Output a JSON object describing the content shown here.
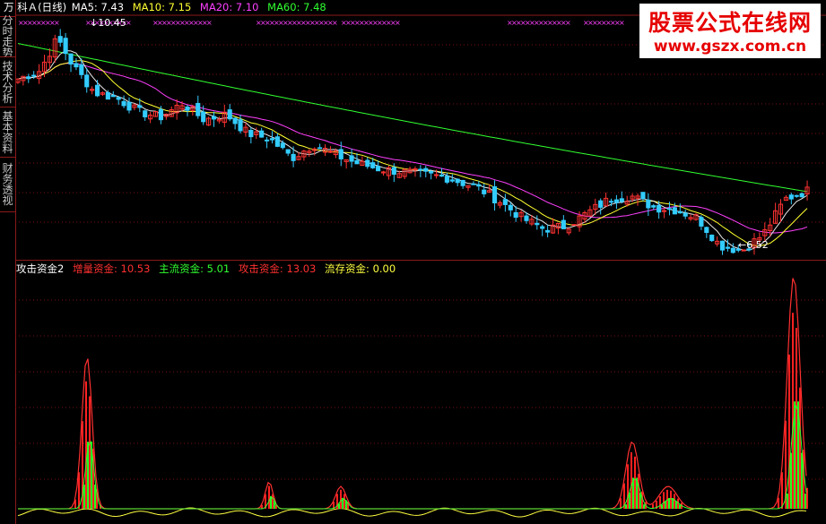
{
  "stock": {
    "name": "万 科Ａ(日线)",
    "ma5_label": "MA5:",
    "ma5": "7.43",
    "ma10_label": "MA10:",
    "ma10": "7.15",
    "ma20_label": "MA20:",
    "ma20": "7.10",
    "ma60_label": "MA60:",
    "ma60": "7.48"
  },
  "side_tabs": [
    {
      "label": "分时走势"
    },
    {
      "label": "技术分析"
    },
    {
      "label": "基本资料"
    },
    {
      "label": "财务透视"
    }
  ],
  "indicator": {
    "name": "攻击资金2",
    "items": [
      {
        "label": "增量资金:",
        "value": "10.53",
        "color": "#ff3030"
      },
      {
        "label": "主流资金:",
        "value": "5.01",
        "color": "#30ff30"
      },
      {
        "label": "攻击资金:",
        "value": "13.03",
        "color": "#ff3030"
      },
      {
        "label": "流存资金:",
        "value": "0.00",
        "color": "#ffff40"
      }
    ]
  },
  "watermark": {
    "line1": "股票公式在线网",
    "line2": "www.gszx.com.cn"
  },
  "chart_data": [
    {
      "type": "candlestick",
      "annotations": [
        {
          "text": "10.45",
          "kind": "high",
          "x": 100
        },
        {
          "text": "6.52",
          "kind": "low",
          "x": 823
        }
      ],
      "series_colors": {
        "up": "#ff3232",
        "down": "#33ccff",
        "ma5": "#e8e8e8",
        "ma10": "#ffff30",
        "ma20": "#ff40ff",
        "ma60": "#30ff30"
      }
    },
    {
      "type": "area",
      "title": "攻击资金2",
      "series": [
        {
          "name": "增量资金",
          "color": "#ff3030"
        },
        {
          "name": "主流资金",
          "color": "#30ff30"
        },
        {
          "name": "攻击资金",
          "color": "#ff3030"
        },
        {
          "name": "流存资金",
          "color": "#ffff40"
        }
      ]
    }
  ]
}
